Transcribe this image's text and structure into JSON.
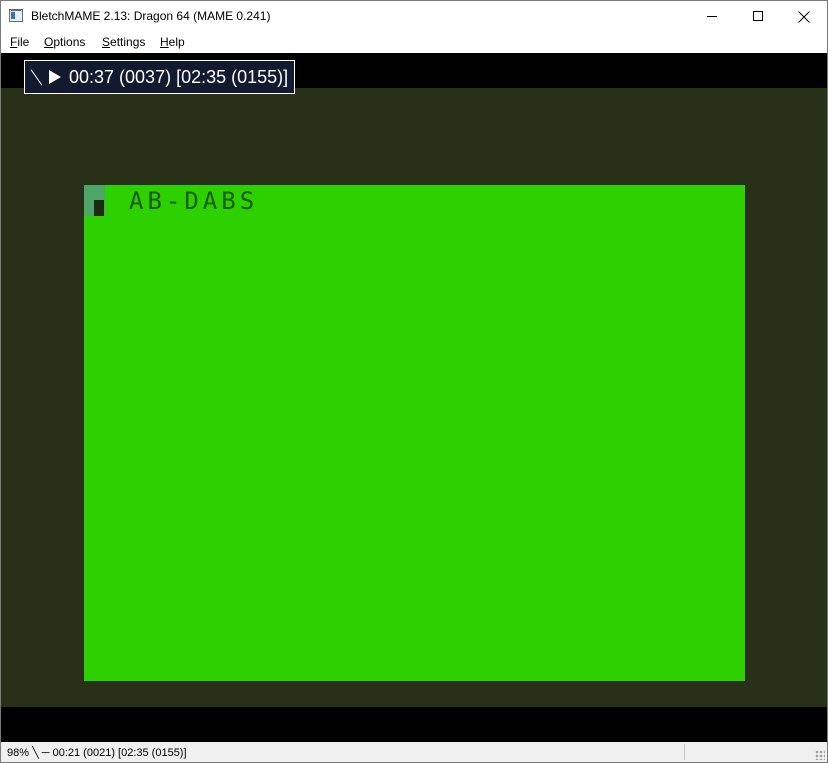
{
  "window": {
    "title": "BletchMAME 2.13: Dragon 64 (MAME 0.241)"
  },
  "menu": {
    "items": [
      {
        "accel": "F",
        "rest": "ile"
      },
      {
        "accel": "O",
        "rest": "ptions"
      },
      {
        "accel": "S",
        "rest": "ettings"
      },
      {
        "accel": "H",
        "rest": "elp"
      }
    ]
  },
  "overlay": {
    "text": "00:37 (0037) [02:35 (0155)]",
    "icons": [
      "slash-icon",
      "play-icon"
    ]
  },
  "screen": {
    "text": "AB-DABS",
    "colors": {
      "screen": "#2dd100",
      "border": "#283118",
      "text": "#1b5a0a",
      "cursor": "#4ea56a"
    }
  },
  "status": {
    "text": "98% ╲ ─ 00:21 (0021) [02:35 (0155)]"
  }
}
